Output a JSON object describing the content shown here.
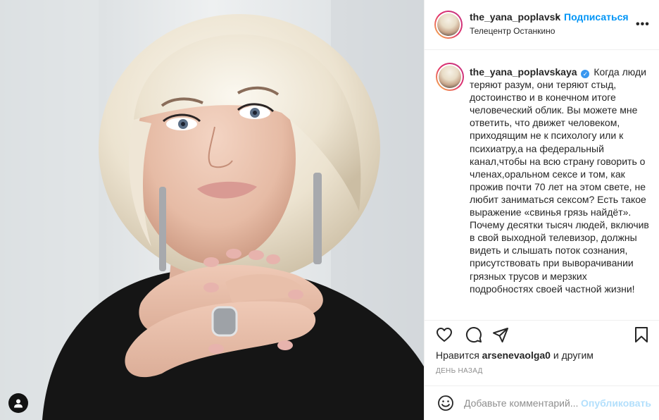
{
  "post": {
    "username": "the_yana_poplavsk",
    "separator": "•",
    "follow_label": "Подписаться",
    "location": "Телецентр Останкино",
    "more_label": "•••"
  },
  "caption": {
    "username": "the_yana_poplavskaya",
    "verified_mark": "✓",
    "text": "Когда люди теряют разум, они теряют стыд, достоинство и в конечном итоге человеческий облик. Вы можете мне ответить, что движет человеком, приходящим не к психологу или к психиатру,а на федеральный канал,чтобы на всю страну говорить о членах,оральном сексе и том, как прожив почти 70 лет на этом свете, не любит заниматься сексом? Есть такое выражение «свинья грязь найдёт». Почему десятки тысяч людей, включив в свой выходной телевизор, должны видеть и слышать поток сознания, присутствовать при выворачивании грязных трусов и мерзких подробностях своей частной жизни!"
  },
  "likes": {
    "prefix": "Нравится",
    "user": "arsenevaolga0",
    "suffix": "и другим"
  },
  "timestamp": "ДЕНЬ НАЗАД",
  "comment": {
    "placeholder": "Добавьте комментарий...",
    "publish_label": "Опубликовать"
  },
  "icons": [
    "heart-icon",
    "comment-icon",
    "share-icon",
    "bookmark-icon",
    "emoji-icon",
    "user-tag-icon",
    "verified-icon"
  ],
  "colors": {
    "accent": "#0095f6",
    "publish_disabled": "#b2dffc",
    "verified": "#3897f0",
    "muted": "#8e8e8e"
  }
}
